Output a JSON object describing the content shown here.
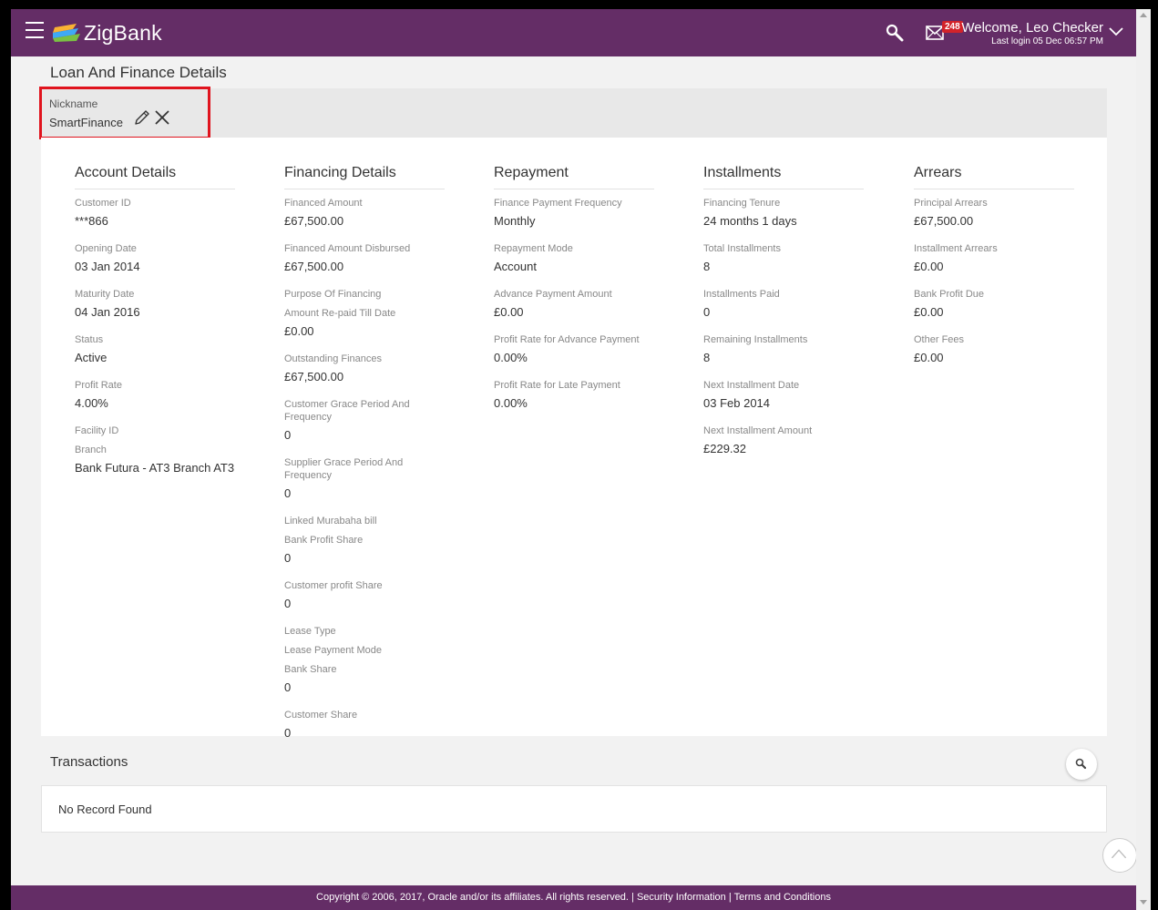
{
  "header": {
    "brand": "ZigBank",
    "mail_count": "248",
    "welcome": "Welcome, Leo Checker",
    "last_login": "Last login 05 Dec 06:57 PM",
    "color": "#642d66"
  },
  "page": {
    "title": "Loan And Finance Details"
  },
  "nickname": {
    "label": "Nickname",
    "value": "SmartFinance"
  },
  "columns": [
    {
      "heading": "Account Details",
      "fields": [
        {
          "label": "Customer ID",
          "value": "***866"
        },
        {
          "label": "Opening Date",
          "value": "03 Jan 2014"
        },
        {
          "label": "Maturity Date",
          "value": "04 Jan 2016"
        },
        {
          "label": "Status",
          "value": "Active"
        },
        {
          "label": "Profit Rate",
          "value": "4.00%"
        },
        {
          "label": "Facility ID",
          "value": ""
        },
        {
          "label": "Branch",
          "value": "Bank Futura - AT3 Branch AT3"
        }
      ]
    },
    {
      "heading": "Financing Details",
      "fields": [
        {
          "label": "Financed Amount",
          "value": "£67,500.00"
        },
        {
          "label": "Financed Amount Disbursed",
          "value": "£67,500.00"
        },
        {
          "label": "Purpose Of Financing",
          "value": ""
        },
        {
          "label": "Amount Re-paid Till Date",
          "value": "£0.00"
        },
        {
          "label": "Outstanding Finances",
          "value": "£67,500.00"
        },
        {
          "label": "Customer Grace Period And Frequency",
          "value": "0"
        },
        {
          "label": "Supplier Grace Period And Frequency",
          "value": "0"
        },
        {
          "label": "Linked Murabaha bill",
          "value": ""
        },
        {
          "label": "Bank Profit Share",
          "value": "0"
        },
        {
          "label": "Customer profit Share",
          "value": "0"
        },
        {
          "label": "Lease Type",
          "value": ""
        },
        {
          "label": "Lease Payment Mode",
          "value": ""
        },
        {
          "label": "Bank Share",
          "value": "0"
        },
        {
          "label": "Customer Share",
          "value": "0"
        }
      ]
    },
    {
      "heading": "Repayment",
      "fields": [
        {
          "label": "Finance Payment Frequency",
          "value": "Monthly"
        },
        {
          "label": "Repayment Mode",
          "value": "Account"
        },
        {
          "label": "Advance Payment Amount",
          "value": "£0.00"
        },
        {
          "label": "Profit Rate for Advance Payment",
          "value": "0.00%"
        },
        {
          "label": "Profit Rate for Late Payment",
          "value": "0.00%"
        }
      ]
    },
    {
      "heading": "Installments",
      "fields": [
        {
          "label": "Financing Tenure",
          "value": "24 months 1 days"
        },
        {
          "label": "Total Installments",
          "value": "8"
        },
        {
          "label": "Installments Paid",
          "value": "0"
        },
        {
          "label": "Remaining Installments",
          "value": "8"
        },
        {
          "label": "Next Installment Date",
          "value": "03 Feb 2014"
        },
        {
          "label": "Next Installment Amount",
          "value": "£229.32"
        }
      ]
    },
    {
      "heading": "Arrears",
      "fields": [
        {
          "label": "Principal Arrears",
          "value": "£67,500.00"
        },
        {
          "label": "Installment Arrears",
          "value": "£0.00"
        },
        {
          "label": "Bank Profit Due",
          "value": "£0.00"
        },
        {
          "label": "Other Fees",
          "value": "£0.00"
        }
      ]
    }
  ],
  "transactions": {
    "title": "Transactions",
    "empty": "No Record Found"
  },
  "footer": {
    "copyright": "Copyright © 2006, 2017, Oracle and/or its affiliates. All rights reserved.",
    "security": "Security Information",
    "terms": "Terms and Conditions"
  }
}
